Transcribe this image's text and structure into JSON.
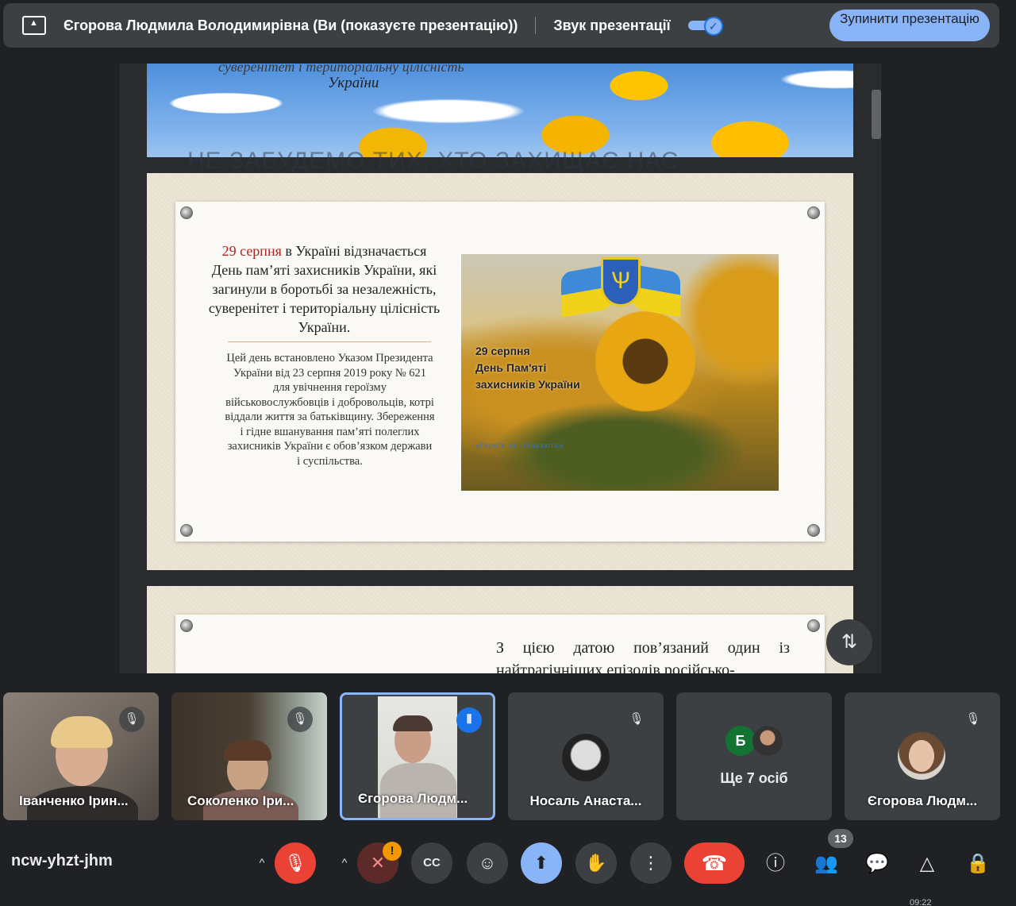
{
  "topbar": {
    "presenter_text": "Єгорова Людмила Володимирівна (Ви (показуєте презентацію))",
    "sound_label": "Звук презентації",
    "stop_button": "Зупинити презентацію",
    "toggle_checkmark": "✓"
  },
  "presentation": {
    "header_line1": "суверенітет і територіальну цілісність",
    "header_line2": "України",
    "ghost_title": "НЕ ЗАБУДЕМО ТИХ, ХТО ЗАХИЩАЄ НАС",
    "slide1": {
      "date": "29 серпня",
      "main_text_rest": " в Україні відзначається День пам’яті захисників України, які загинули в боротьбі за незалежність, суверенітет і територіальну цілісність України.",
      "sub_text": "Цей день встановлено Указом Президента України від 23 серпня 2019 року № 621 для увічнення героїзму військовослужбовців і добровольців, котрі віддали життя за батьківщину. Збереження і гідне вшанування пам’яті полеглих захисників України є обов’язком держави і суспільства.",
      "photo_caption_1": "29 серпня",
      "photo_caption_2": "День Пам'яті",
      "photo_caption_3": "захисників України",
      "photo_small": "«Героїв не вбивають»",
      "trident": "Ѱ"
    },
    "slide2": {
      "text": "З цією датою пов’язаний один із найтрагічніших епізодів російсько-"
    }
  },
  "icons": {
    "scroll_fab": "⇅",
    "mic_off": "🎙",
    "speaking": "⦀",
    "mic_button": "🎙",
    "camera": "✕",
    "warn": "!",
    "captions": "CC",
    "emoji": "☺",
    "present": "⬆",
    "hand": "✋",
    "more": "⋮",
    "hangup": "☎",
    "info": "ⓘ",
    "people": "👥",
    "chat": "💬",
    "activities": "△",
    "lock": "🔒",
    "caret": "^"
  },
  "participants": [
    {
      "name": "Іванченко Ірин...",
      "muted": true
    },
    {
      "name": "Соколенко Іри...",
      "muted": true
    },
    {
      "name": "Єгорова Людм...",
      "speaking": true
    },
    {
      "name": "Носаль Анаста...",
      "muted": true
    },
    {
      "name": "Ще 7 осіб",
      "avatar_letter": "Б"
    },
    {
      "name": "Єгорова Людм...",
      "muted": true
    }
  ],
  "toolbar": {
    "meeting_code": "ncw-yhzt-jhm",
    "people_count": "13",
    "clock": "09:22"
  },
  "colors": {
    "background": "#202124",
    "accent_blue": "#8ab4f8",
    "hangup_red": "#ea4335"
  }
}
